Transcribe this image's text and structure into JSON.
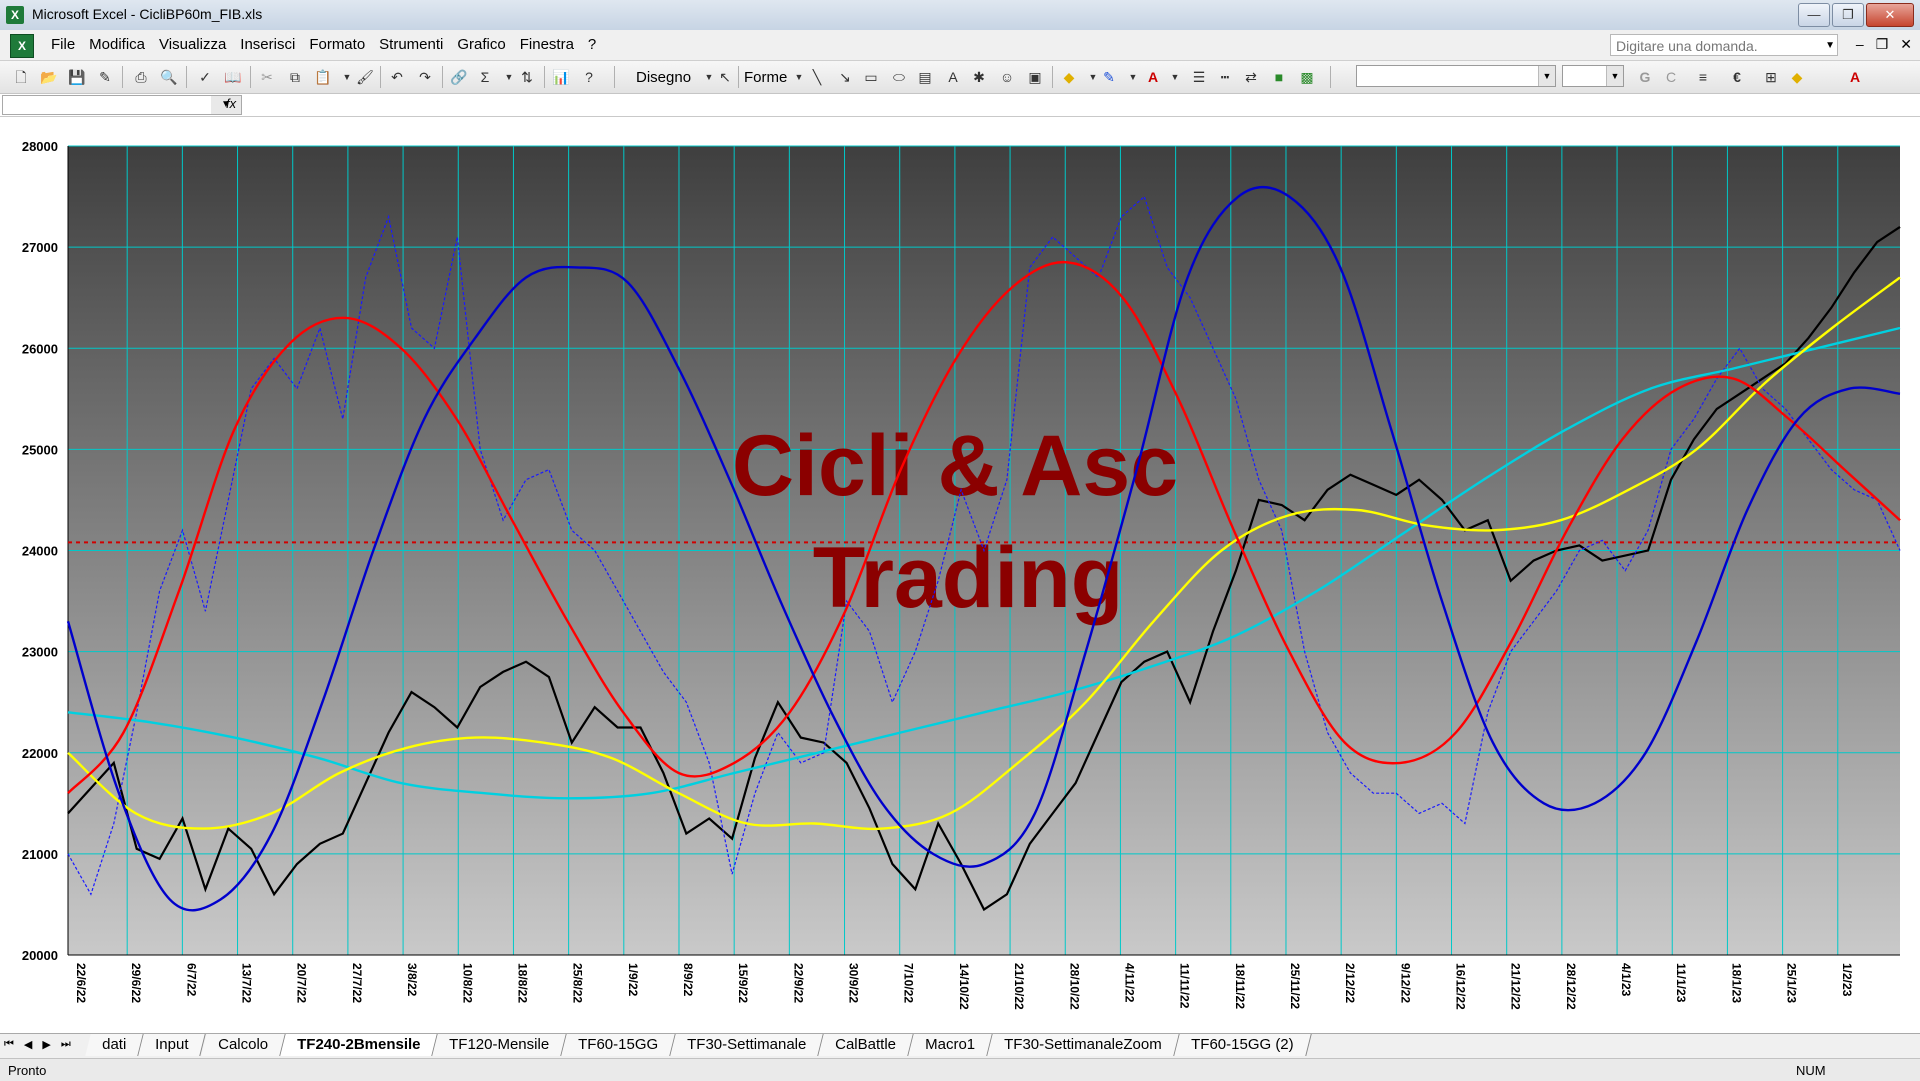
{
  "window": {
    "title": "Microsoft Excel - CicliBP60m_FIB.xls",
    "min": "—",
    "max": "❐",
    "close": "✕"
  },
  "menu": {
    "items": [
      "File",
      "Modifica",
      "Visualizza",
      "Inserisci",
      "Formato",
      "Strumenti",
      "Grafico",
      "Finestra",
      "?"
    ],
    "ask_placeholder": "Digitare una domanda.",
    "doc_controls": [
      "–",
      "❐",
      "✕"
    ]
  },
  "toolbar": {
    "disegno": "Disegno",
    "forme": "Forme"
  },
  "formula": {
    "fx": "fx"
  },
  "chart_data": {
    "type": "line",
    "title": "",
    "watermark": [
      "Cicli & Asc",
      "Trading"
    ],
    "ylim": [
      20000,
      28000
    ],
    "y_ticks": [
      "20000",
      "21000",
      "22000",
      "23000",
      "24000",
      "25000",
      "26000",
      "27000",
      "28000"
    ],
    "x_ticks": [
      "22/6/22",
      "29/6/22",
      "6/7/22",
      "13/7/22",
      "20/7/22",
      "27/7/22",
      "3/8/22",
      "10/8/22",
      "18/8/22",
      "25/8/22",
      "1/9/22",
      "8/9/22",
      "15/9/22",
      "22/9/22",
      "30/9/22",
      "7/10/22",
      "14/10/22",
      "21/10/22",
      "28/10/22",
      "4/11/22",
      "11/11/22",
      "18/11/22",
      "25/11/22",
      "2/12/22",
      "9/12/22",
      "16/12/22",
      "21/12/22",
      "28/12/22",
      "4/1/23",
      "11/1/23",
      "18/1/23",
      "25/1/23",
      "1/2/23"
    ],
    "reference_line": {
      "value": 24080,
      "color": "#d00000",
      "style": "dashed"
    },
    "series": [
      {
        "style": "price",
        "color": "#000000",
        "values": [
          21400,
          21650,
          21900,
          21050,
          20950,
          21350,
          20650,
          21250,
          21050,
          20600,
          20900,
          21100,
          21200,
          21700,
          22200,
          22600,
          22450,
          22250,
          22650,
          22800,
          22900,
          22750,
          22100,
          22450,
          22250,
          22250,
          21800,
          21200,
          21350,
          21150,
          21950,
          22500,
          22150,
          22100,
          21900,
          21450,
          20900,
          20650,
          21300,
          20900,
          20450,
          20600,
          21100,
          21400,
          21700,
          22200,
          22700,
          22900,
          23000,
          22500,
          23200,
          23800,
          24500,
          24450,
          24300,
          24600,
          24750,
          24650,
          24550,
          24700,
          24500,
          24200,
          24300,
          23700,
          23900,
          24000,
          24050,
          23900,
          23950,
          24000,
          24700,
          25100,
          25400,
          25550,
          25700,
          25850,
          26100,
          26400,
          26750,
          27050,
          27200
        ]
      },
      {
        "style": "dotted",
        "color": "#1a1aff",
        "values": [
          21000,
          20600,
          21300,
          22400,
          23600,
          24200,
          23400,
          24500,
          25600,
          25900,
          25600,
          26200,
          25300,
          26700,
          27300,
          26200,
          26000,
          27100,
          25000,
          24300,
          24700,
          24800,
          24200,
          24000,
          23600,
          23200,
          22800,
          22500,
          21900,
          20800,
          21600,
          22200,
          21900,
          22000,
          23500,
          23200,
          22500,
          23000,
          23700,
          24600,
          24000,
          24700,
          26800,
          27100,
          26900,
          26700,
          27300,
          27500,
          26800,
          26500,
          26000,
          25500,
          24700,
          24200,
          23000,
          22200,
          21800,
          21600,
          21600,
          21400,
          21500,
          21300,
          22400,
          23000,
          23300,
          23600,
          24000,
          24100,
          23800,
          24200,
          25000,
          25300,
          25700,
          26000,
          25600,
          25400,
          25100,
          24800,
          24600,
          24500,
          24000
        ]
      },
      {
        "style": "smooth",
        "color": "#00d0e0",
        "values": [
          22400,
          22300,
          22150,
          21950,
          21700,
          21600,
          21550,
          21600,
          21800,
          22000,
          22200,
          22400,
          22600,
          22850,
          23150,
          23600,
          24150,
          24700,
          25200,
          25600,
          25800,
          26000,
          26200
        ]
      },
      {
        "style": "smooth",
        "color": "#ffff00",
        "values": [
          22000,
          21400,
          21250,
          21400,
          21800,
          22050,
          22150,
          22100,
          21950,
          21600,
          21300,
          21300,
          21250,
          21400,
          21900,
          22500,
          23300,
          24000,
          24350,
          24400,
          24250,
          24200,
          24300,
          24600,
          25000,
          25650,
          26200,
          26700
        ]
      },
      {
        "style": "smooth",
        "color": "#ff0000",
        "values": [
          21600,
          22200,
          23600,
          25200,
          26050,
          26300,
          26000,
          25300,
          24300,
          23300,
          22400,
          21800,
          21900,
          22400,
          23400,
          24800,
          25900,
          26600,
          26850,
          26500,
          25500,
          24200,
          23000,
          22100,
          21900,
          22200,
          23100,
          24200,
          25100,
          25600,
          25700,
          25300,
          24800,
          24300
        ]
      },
      {
        "style": "smooth",
        "color": "#0000cc",
        "values": [
          23300,
          21600,
          20550,
          20550,
          21200,
          22500,
          24000,
          25300,
          26100,
          26700,
          26800,
          26650,
          25800,
          24700,
          23500,
          22400,
          21500,
          21000,
          20900,
          21400,
          23000,
          24800,
          26700,
          27500,
          27500,
          26800,
          25200,
          23500,
          22100,
          21500,
          21500,
          22000,
          23100,
          24400,
          25300,
          25600,
          25550
        ]
      }
    ]
  },
  "sheets": {
    "tabs": [
      "dati",
      "Input",
      "Calcolo",
      "TF240-2Bmensile",
      "TF120-Mensile",
      "TF60-15GG",
      "TF30-Settimanale",
      "CalBattle",
      "Macro1",
      "TF30-SettimanaleZoom",
      "TF60-15GG (2)"
    ],
    "active_index": 3
  },
  "status": {
    "left": "Pronto",
    "num": "NUM"
  }
}
